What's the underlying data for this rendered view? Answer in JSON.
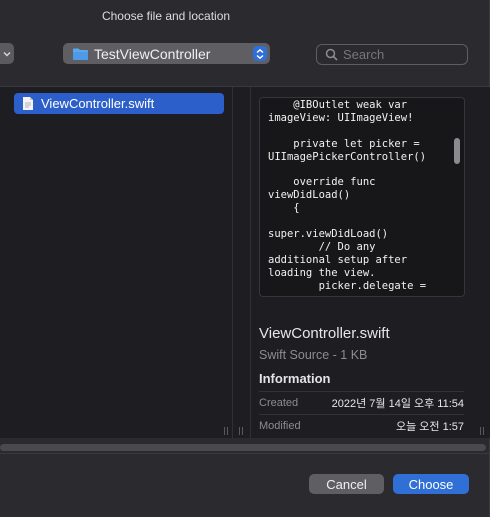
{
  "dialog": {
    "title": "Choose file and location"
  },
  "toolbar": {
    "location": "TestViewController",
    "search_placeholder": "Search"
  },
  "file_list": {
    "items": [
      {
        "name": "ViewController.swift",
        "selected": true
      }
    ]
  },
  "preview": {
    "code": "collection: [UIImageView]!\n    @IBOutlet weak var\nimageView: UIImageView!\n\n    private let picker =\nUIImagePickerController()\n\n    override func\nviewDidLoad()\n    {\n\nsuper.viewDidLoad()\n        // Do any\nadditional setup after\nloading the view.\n        picker.delegate =",
    "file_name": "ViewController.swift",
    "kind": "Swift Source - 1 KB",
    "info_heading": "Information",
    "info": [
      {
        "key": "Created",
        "value": "2022년 7월 14일 오후 11:54"
      },
      {
        "key": "Modified",
        "value": "오늘 오전 1:57"
      }
    ]
  },
  "buttons": {
    "cancel": "Cancel",
    "choose": "Choose"
  },
  "colors": {
    "accent": "#2f6fd6",
    "selection": "#2d5fcb"
  }
}
